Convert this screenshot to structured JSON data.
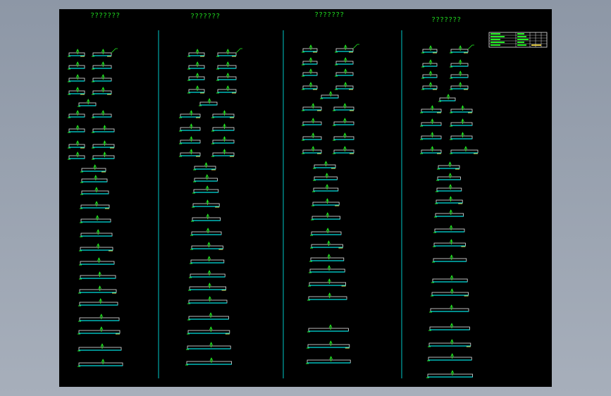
{
  "drawing": {
    "background_color": "#000000",
    "page_color": "#9aa3b0",
    "colors": {
      "title": "#1fd61f",
      "divider": "#00c8c8",
      "shape": "#e8e8e8",
      "accent_cyan": "#00e0e0",
      "accent_green": "#22ee22",
      "accent_yellow": "#e8d048"
    },
    "columns": [
      {
        "title": "???????"
      },
      {
        "title": "???????"
      },
      {
        "title": "???????"
      },
      {
        "title": "???????"
      }
    ],
    "title_block": {
      "present": true
    }
  }
}
